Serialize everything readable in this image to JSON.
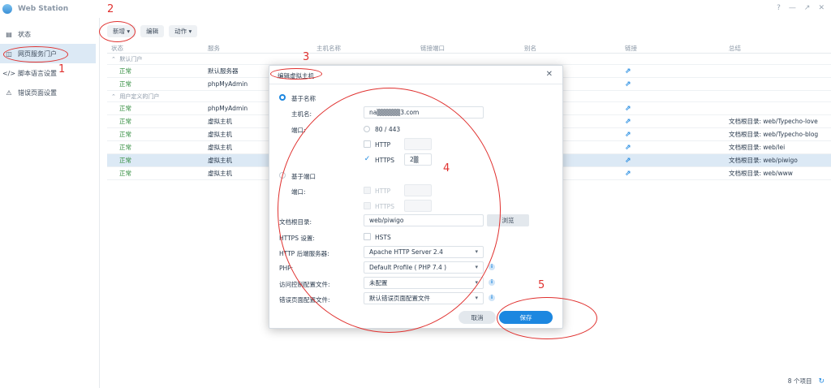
{
  "app": {
    "title": "Web Station"
  },
  "window_controls": [
    "?",
    "—",
    "↗",
    "✕"
  ],
  "sidebar": {
    "items": [
      {
        "label": "状态",
        "icon": "status-icon"
      },
      {
        "label": "网页服务门户",
        "icon": "portal-icon",
        "active": true
      },
      {
        "label": "脚本语言设置",
        "icon": "code-icon"
      },
      {
        "label": "错误页面设置",
        "icon": "error-icon"
      }
    ]
  },
  "toolbar": {
    "add_label": "新增",
    "edit_label": "编辑",
    "action_label": "动作"
  },
  "table": {
    "columns": [
      "状态",
      "服务",
      "主机名称",
      "链接端口",
      "别名",
      "链接",
      "总结"
    ],
    "groups": [
      {
        "label": "默认门户",
        "rows": [
          {
            "status": "正常",
            "service": "默认服务器",
            "summary": ""
          },
          {
            "status": "正常",
            "service": "phpMyAdmin",
            "summary": ""
          }
        ]
      },
      {
        "label": "用户定义的门户",
        "rows": [
          {
            "status": "正常",
            "service": "phpMyAdmin",
            "summary": ""
          },
          {
            "status": "正常",
            "service": "虚拟主机",
            "summary": "文档根目录: web/Typecho-love"
          },
          {
            "status": "正常",
            "service": "虚拟主机",
            "summary": "文档根目录: web/Typecho-blog"
          },
          {
            "status": "正常",
            "service": "虚拟主机",
            "summary": "文档根目录: web/lei"
          },
          {
            "status": "正常",
            "service": "虚拟主机",
            "summary": "文档根目录: web/piwigo",
            "selected": true
          },
          {
            "status": "正常",
            "service": "虚拟主机",
            "summary": "文档根目录: web/www"
          }
        ]
      }
    ]
  },
  "footer": {
    "count": "8 个项目"
  },
  "dialog": {
    "title": "编辑虚拟主机",
    "name_based_label": "基于名称",
    "hostname_label": "主机名:",
    "hostname_value": "na▒▒▒▒▒3.com",
    "port_label": "端口:",
    "port_80_443": "80 / 443",
    "http_label": "HTTP",
    "https_label": "HTTPS",
    "https_port_value": "2▒",
    "port_based_label": "基于端口",
    "port_label2": "端口:",
    "http_label2": "HTTP",
    "https_label2": "HTTPS",
    "docroot_label": "文档根目录:",
    "docroot_value": "web/piwigo",
    "browse_label": "浏览",
    "https_settings_label": "HTTPS 设置:",
    "hsts_label": "HSTS",
    "backend_label": "HTTP 后端服务器:",
    "backend_value": "Apache HTTP Server 2.4",
    "php_label": "PHP:",
    "php_value": "Default Profile ( PHP 7.4 )",
    "access_label": "访问控制配置文件:",
    "access_value": "未配置",
    "errorpage_label": "错误页面配置文件:",
    "errorpage_value": "默认错误页面配置文件",
    "cancel_label": "取消",
    "save_label": "保存"
  },
  "annotations": [
    "1",
    "2",
    "3",
    "4",
    "5"
  ]
}
